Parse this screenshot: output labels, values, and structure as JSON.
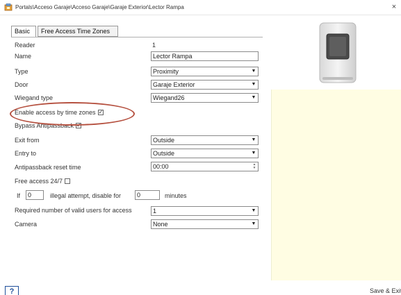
{
  "window": {
    "title": "Portals\\Acceso Garaje\\Acceso Garaje\\Garaje Exterior\\Lector Rampa",
    "close_glyph": "×",
    "icon": "app-icon"
  },
  "tabs": [
    {
      "label": "Basic",
      "active": true
    },
    {
      "label": "Free Access Time Zones",
      "active": false
    }
  ],
  "form": {
    "reader": {
      "label": "Reader",
      "value": "1"
    },
    "name": {
      "label": "Name",
      "value": "Lector Rampa"
    },
    "type": {
      "label": "Type",
      "value": "Proximity"
    },
    "door": {
      "label": "Door",
      "value": "Garaje Exterior"
    },
    "wiegand": {
      "label": "Wiegand type",
      "value": "Wiegand26"
    },
    "enable_tz": {
      "label": "Enable access by time zones",
      "checked": true
    },
    "bypass": {
      "label": "Bypass Antipassback",
      "checked": true
    },
    "exit_from": {
      "label": "Exit from",
      "value": "Outside"
    },
    "entry_to": {
      "label": "Entry to",
      "value": "Outside"
    },
    "apb_reset": {
      "label": "Antipassback reset time",
      "value": "00:00"
    },
    "free_access": {
      "label": "Free access 24/7",
      "checked": false
    },
    "illegal": {
      "prefix": "If",
      "attempts": "0",
      "middle": "illegal attempt, disable for",
      "minutes": "0",
      "suffix": "minutes"
    },
    "required_users": {
      "label": "Required number of valid users for access",
      "value": "1"
    },
    "camera": {
      "label": "Camera",
      "value": "None"
    }
  },
  "glyphs": {
    "dropdown": "▼",
    "check": "✓",
    "spin_up": "▲",
    "spin_down": "▼"
  },
  "footer": {
    "help_label": "?",
    "save_exit_label": "Save & Exit"
  },
  "colors": {
    "preview_bg": "#fffde3",
    "highlight": "#b5503f",
    "help_blue": "#1f4f9a"
  }
}
